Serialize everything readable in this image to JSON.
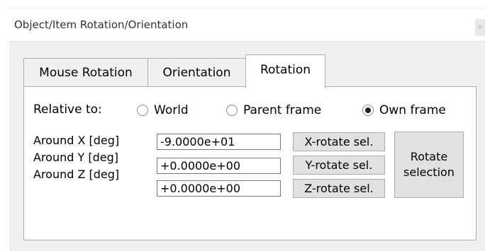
{
  "window": {
    "title": "Object/Item Rotation/Orientation",
    "title_button_glyph": "×"
  },
  "tabs": [
    {
      "label": "Mouse Rotation",
      "selected": false
    },
    {
      "label": "Orientation",
      "selected": false
    },
    {
      "label": "Rotation",
      "selected": true
    }
  ],
  "relative": {
    "label": "Relative to:",
    "options": [
      {
        "label": "World",
        "checked": false
      },
      {
        "label": "Parent frame",
        "checked": false
      },
      {
        "label": "Own frame",
        "checked": true
      }
    ]
  },
  "rows": [
    {
      "label": "Around X [deg]",
      "value": "-9.0000e+01",
      "button": "X-rotate sel."
    },
    {
      "label": "Around Y [deg]",
      "value": "+0.0000e+00",
      "button": "Y-rotate sel."
    },
    {
      "label": "Around Z [deg]",
      "value": "+0.0000e+00",
      "button": "Z-rotate sel."
    }
  ],
  "rotate_button": {
    "line1": "Rotate",
    "line2": "selection"
  }
}
